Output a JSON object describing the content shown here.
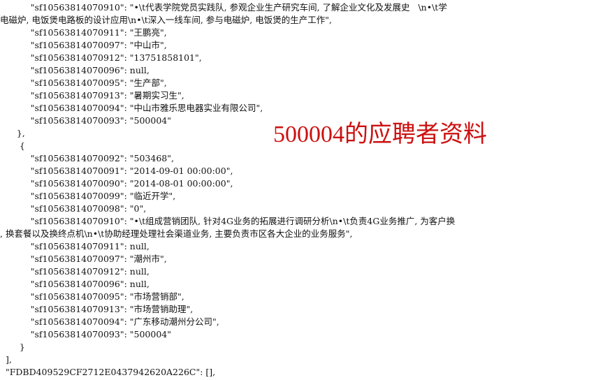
{
  "json_viewer": {
    "lines": [
      "           \"sf10563814070910\": \"•\\t代表学院党员实践队, 参观企业生产研究车间, 了解企业文化及发展史   \\n•\\t学",
      "电磁炉, 电饭煲电路板的设计应用\\n•\\t深入一线车间, 参与电磁炉, 电饭煲的生产工作\",",
      "           \"sf10563814070911\": \"王鹏亮\",",
      "           \"sf10563814070097\": \"中山市\",",
      "           \"sf10563814070912\": \"13751858101\",",
      "           \"sf10563814070096\": null,",
      "           \"sf10563814070095\": \"生产部\",",
      "           \"sf10563814070913\": \"暑期实习生\",",
      "           \"sf10563814070094\": \"中山市雅乐思电器实业有限公司\",",
      "           \"sf10563814070093\": \"500004\"",
      "      },",
      "       {",
      "           \"sf10563814070092\": \"503468\",",
      "           \"sf10563814070091\": \"2014-09-01 00:00:00\",",
      "           \"sf10563814070090\": \"2014-08-01 00:00:00\",",
      "           \"sf10563814070099\": \"临近开学\",",
      "           \"sf10563814070098\": \"0\",",
      "           \"sf10563814070910\": \"•\\t组成营销团队, 针对4G业务的拓展进行调研分析\\n•\\t负责4G业务推广, 为客户换",
      ", 换套餐以及换终点机\\n•\\t协助经理处理社会渠道业务, 主要负责市区各大企业的业务服务\",",
      "           \"sf10563814070911\": null,",
      "           \"sf10563814070097\": \"潮州市\",",
      "           \"sf10563814070912\": null,",
      "           \"sf10563814070096\": null,",
      "           \"sf10563814070095\": \"市场营销部\",",
      "           \"sf10563814070913\": \"市场营销助理\",",
      "           \"sf10563814070094\": \"广东移动潮州分公司\",",
      "           \"sf10563814070093\": \"500004\"",
      "       }",
      "  ],",
      "  \"FDBD409529CF2712E0437942620A226C\": [],"
    ]
  },
  "annotation": {
    "label": "500004的应聘者资料",
    "color": "#cc1111"
  }
}
